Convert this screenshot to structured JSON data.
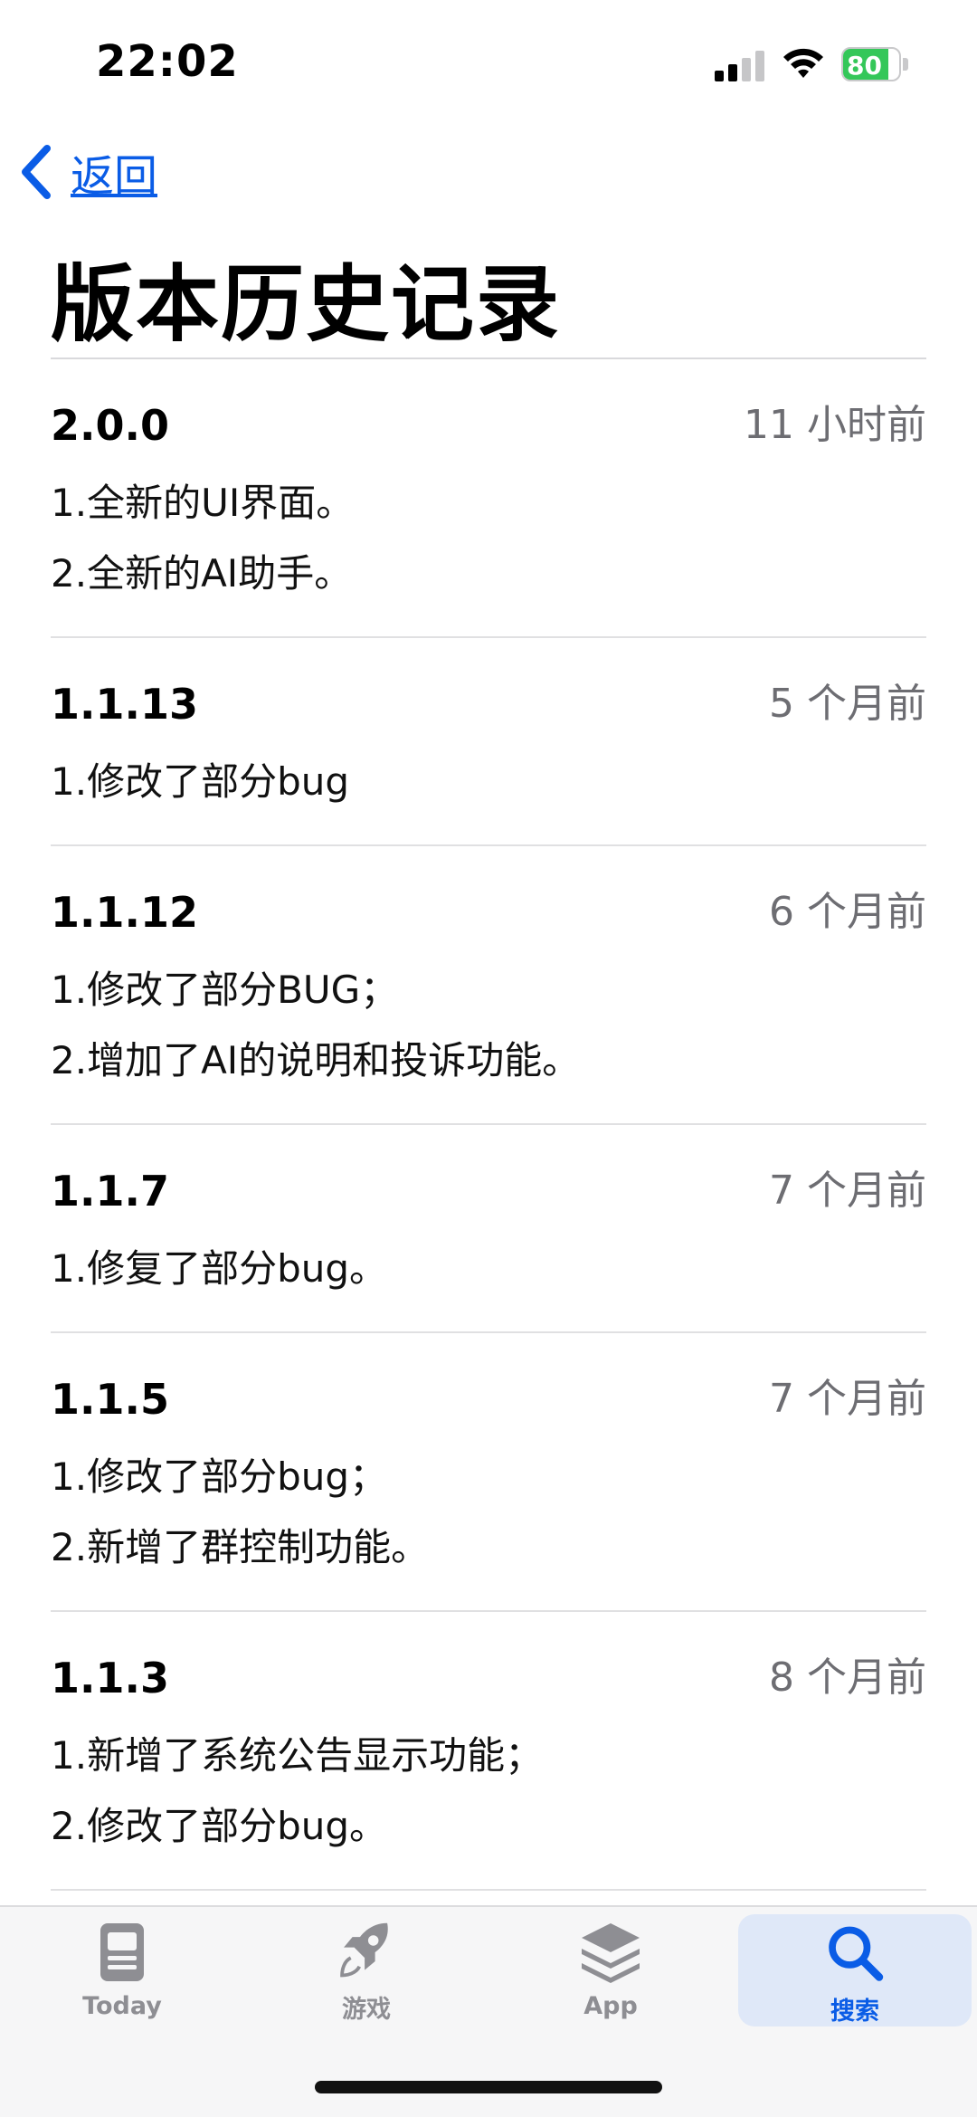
{
  "status": {
    "time": "22:02",
    "battery": "80",
    "battery_level": 0.8,
    "battery_color": "#34c759"
  },
  "nav": {
    "back_label": "返回",
    "title": "版本历史记录",
    "accent_color": "#0a5ce6"
  },
  "entries": [
    {
      "version": "2.0.0",
      "date": "11 小时前",
      "notes": [
        "1.全新的UI界面。",
        "2.全新的AI助手。"
      ]
    },
    {
      "version": "1.1.13",
      "date": "5 个月前",
      "notes": [
        "1.修改了部分bug"
      ]
    },
    {
      "version": "1.1.12",
      "date": "6 个月前",
      "notes": [
        "1.修改了部分BUG；",
        "2.增加了AI的说明和投诉功能。"
      ]
    },
    {
      "version": "1.1.7",
      "date": "7 个月前",
      "notes": [
        "1.修复了部分bug。"
      ]
    },
    {
      "version": "1.1.5",
      "date": "7 个月前",
      "notes": [
        "1.修改了部分bug；",
        "2.新增了群控制功能。"
      ]
    },
    {
      "version": "1.1.3",
      "date": "8 个月前",
      "notes": [
        "1.新增了系统公告显示功能；",
        "2.修改了部分bug。"
      ]
    }
  ],
  "tabs": [
    {
      "label": "Today",
      "icon": "today-icon",
      "active": false
    },
    {
      "label": "游戏",
      "icon": "rocket-icon",
      "active": false
    },
    {
      "label": "App",
      "icon": "apps-stack-icon",
      "active": false
    },
    {
      "label": "搜索",
      "icon": "search-icon",
      "active": true
    }
  ]
}
